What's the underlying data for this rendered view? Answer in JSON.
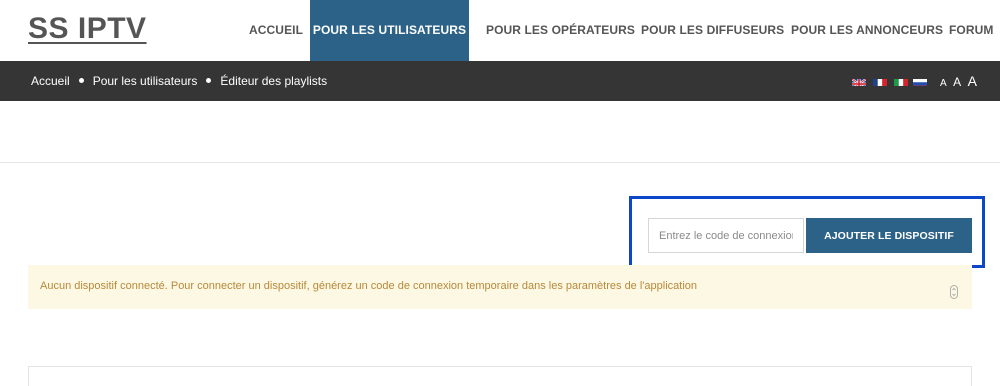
{
  "header": {
    "logo": "SS IPTV",
    "nav": [
      {
        "label": "ACCUEIL",
        "active": false
      },
      {
        "label": "POUR LES UTILISATEURS",
        "active": true
      },
      {
        "label": "POUR LES OPÉRATEURS",
        "active": false
      },
      {
        "label": "POUR LES DIFFUSEURS",
        "active": false
      },
      {
        "label": "POUR LES ANNONCEURS",
        "active": false
      },
      {
        "label": "FORUM",
        "active": false
      }
    ]
  },
  "breadcrumb": {
    "items": [
      "Accueil",
      "Pour les utilisateurs",
      "Éditeur des playlists"
    ]
  },
  "languages": [
    "uk-flag-icon",
    "france-flag-icon",
    "italy-flag-icon",
    "russia-flag-icon"
  ],
  "font_size_controls": [
    "A",
    "A",
    "A"
  ],
  "device_form": {
    "placeholder": "Entrez le code de connexion",
    "button_label": "AJOUTER LE DISPOSITIF"
  },
  "alert": {
    "message": "Aucun dispositif connecté. Pour connecter un dispositif, générez un code de connexion temporaire dans les paramètres de l'application"
  },
  "colors": {
    "accent": "#2d6288",
    "dark_bar": "#353535",
    "alert_bg": "#fcf8e3",
    "alert_text": "#b8893a",
    "highlight_border": "#0d47c9"
  }
}
